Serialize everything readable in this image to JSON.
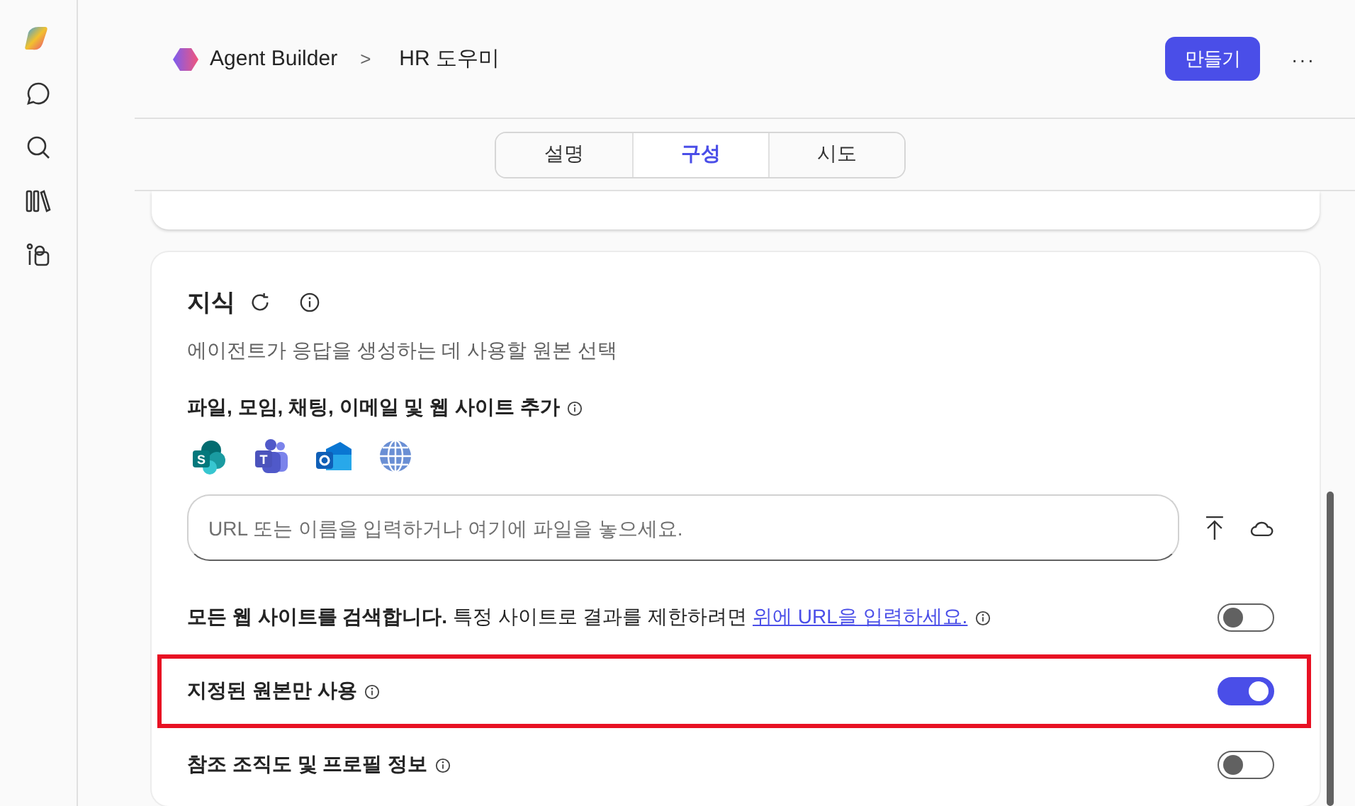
{
  "breadcrumb": {
    "app": "Agent Builder",
    "separator": ">",
    "current": "HR 도우미"
  },
  "header": {
    "create_button": "만들기",
    "more_button": "···"
  },
  "tabs": [
    {
      "label": "설명",
      "selected": false
    },
    {
      "label": "구성",
      "selected": true
    },
    {
      "label": "시도",
      "selected": false
    }
  ],
  "knowledge": {
    "title": "지식",
    "subtitle": "에이전트가 응답을 생성하는 데 사용할 원본 선택",
    "add_heading": "파일, 모임, 채팅, 이메일 및 웹 사이트 추가",
    "sources": [
      {
        "kind": "sharepoint",
        "letter": "S"
      },
      {
        "kind": "teams",
        "letter": "T"
      },
      {
        "kind": "outlook"
      },
      {
        "kind": "web"
      }
    ],
    "input": {
      "placeholder": "URL 또는 이름을 입력하거나 여기에 파일을 놓으세요."
    },
    "options": [
      {
        "text": "**모든 웹 사이트를 검색합니다.** 특정 사이트로 결과를 제한하려면 ",
        "link": "위에 URL을 입력하세요.",
        "on": false,
        "highlighted": false
      },
      {
        "text": "**지정된 원본만 사용**",
        "on": true,
        "highlighted": true
      },
      {
        "text": "**참조 조직도 및 프로필 정보**",
        "on": false,
        "highlighted": false
      }
    ]
  }
}
